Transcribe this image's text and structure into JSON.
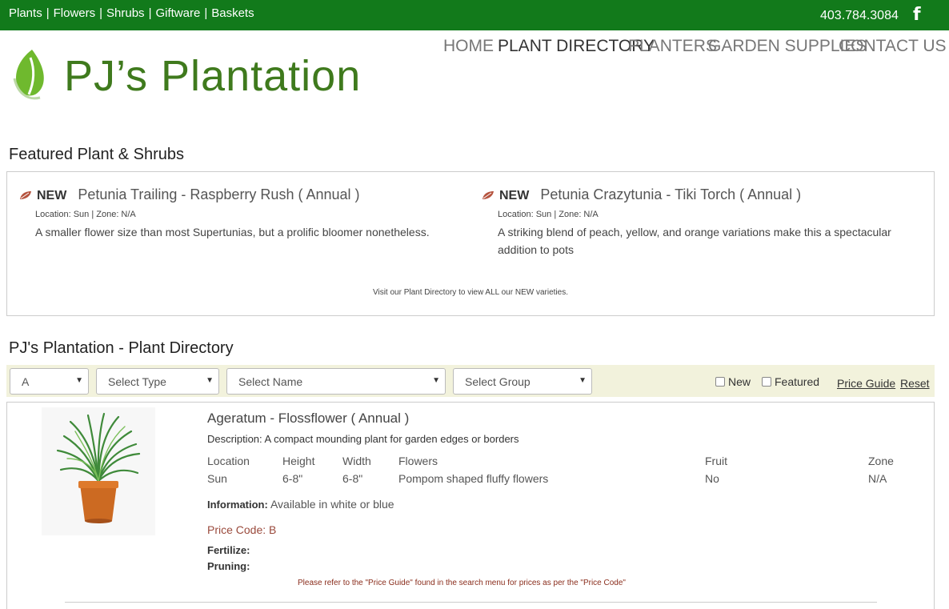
{
  "topbar": {
    "links": [
      "Plants",
      "Flowers",
      "Shrubs",
      "Giftware",
      "Baskets"
    ],
    "separator": "|",
    "phone": "403.784.3084",
    "facebook_icon": "f"
  },
  "brand": {
    "name": "PJ’s Plantation"
  },
  "nav": {
    "items": [
      "HOME",
      "PLANT DIRECTORY",
      "PLANTERS",
      "GARDEN SUPPLIES",
      "CONTACT US"
    ],
    "active": "PLANT DIRECTORY"
  },
  "featured": {
    "heading": "Featured Plant & Shrubs",
    "items": [
      {
        "badge": "NEW",
        "title": "Petunia Trailing -  Raspberry Rush ( Annual )",
        "location": "Location: Sun | Zone: N/A",
        "description": "A smaller flower size than most Supertunias, but a prolific bloomer nonetheless."
      },
      {
        "badge": "NEW",
        "title": "Petunia Crazytunia -  Tiki Torch ( Annual )",
        "location": "Location: Sun | Zone: N/A",
        "description": "A striking blend of peach, yellow, and orange variations make this a spectacular addition to pots"
      }
    ],
    "visit_note": "Visit our Plant Directory to view ALL our NEW varieties."
  },
  "directory": {
    "heading": "PJ's Plantation - Plant Directory",
    "filters": {
      "letter": "A",
      "type": "Select Type",
      "name": "Select Name",
      "group": "Select Group",
      "new_label": "New",
      "featured_label": "Featured",
      "price_guide": "Price Guide",
      "reset": "Reset"
    },
    "plant": {
      "title": "Ageratum - Flossflower ( Annual )",
      "description": "Description: A compact mounding plant for garden edges or borders",
      "columns": [
        "Location",
        "Height",
        "Width",
        "Flowers",
        "Fruit",
        "Zone"
      ],
      "values": [
        "Sun",
        "6-8\"",
        "6-8\"",
        "Pompom shaped fluffy flowers",
        "No",
        "N/A"
      ],
      "information_label": "Information:",
      "information": "Available in white or blue",
      "price_code": "Price Code: B",
      "fertilize_label": "Fertilize:",
      "pruning_label": "Pruning:",
      "price_note": "Please refer to the \"Price Guide\" found in the search menu for prices as per the \"Price Code\""
    }
  },
  "colors": {
    "topbar": "#127a1b",
    "brand": "#3f7a1d",
    "filter_bar": "#f2f2dc",
    "price": "#9a4a3c"
  }
}
